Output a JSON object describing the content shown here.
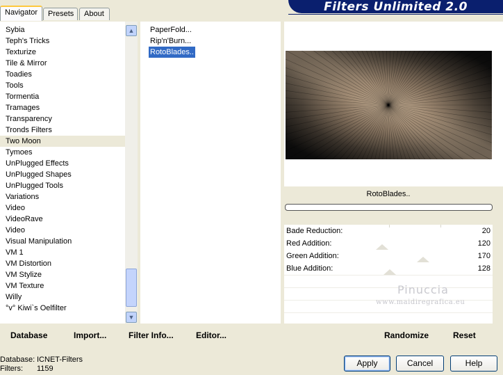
{
  "tabs": [
    {
      "label": "Navigator",
      "active": true
    },
    {
      "label": "Presets",
      "active": false
    },
    {
      "label": "About",
      "active": false
    }
  ],
  "banner_title": "Filters Unlimited 2.0",
  "categories": [
    "Sybia",
    "Teph's Tricks",
    "Texturize",
    "Tile & Mirror",
    "Toadies",
    "Tools",
    "Tormentia",
    "Tramages",
    "Transparency",
    "Tronds Filters",
    "Two Moon",
    "Tymoes",
    "UnPlugged Effects",
    "UnPlugged Shapes",
    "UnPlugged Tools",
    "Variations",
    "Video",
    "VideoRave",
    "Video",
    "Visual Manipulation",
    "VM 1",
    "VM Distortion",
    "VM Stylize",
    "VM Texture",
    "Willy",
    "°v° Kiwi`s Oelfilter"
  ],
  "selected_category": "Two Moon",
  "filters": [
    "PaperFold...",
    "Rip'n'Burn...",
    "RotoBlades.."
  ],
  "selected_filter": "RotoBlades..",
  "filter_name": "RotoBlades..",
  "params": [
    {
      "label": "Bade Reduction:",
      "value": "20"
    },
    {
      "label": "Red Addition:",
      "value": "120"
    },
    {
      "label": "Green Addition:",
      "value": "170"
    },
    {
      "label": "Blue Addition:",
      "value": "128"
    }
  ],
  "watermark": {
    "line1": "Pinuccia",
    "line2": "www.maidiregrafica.eu"
  },
  "bottom_links": {
    "database": "Database",
    "import": "Import...",
    "filter_info": "Filter Info...",
    "editor": "Editor...",
    "randomize": "Randomize",
    "reset": "Reset"
  },
  "status": {
    "database_label": "Database:",
    "database_value": "ICNET-Filters",
    "filters_label": "Filters:",
    "filters_value": "1159"
  },
  "buttons": {
    "apply": "Apply",
    "cancel": "Cancel",
    "help": "Help"
  },
  "icons": {
    "scroll_up": "triangle-up",
    "scroll_down": "triangle-down"
  }
}
